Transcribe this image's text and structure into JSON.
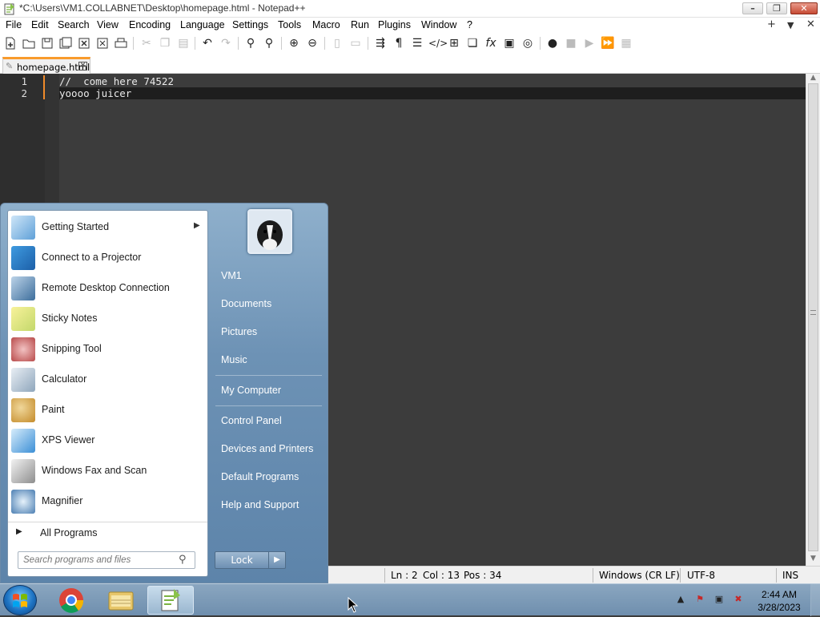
{
  "window": {
    "title": "*C:\\Users\\VM1.COLLABNET\\Desktop\\homepage.html - Notepad++",
    "minimize": "–",
    "restore": "❐",
    "close": "✕"
  },
  "menubar": {
    "items": [
      "File",
      "Edit",
      "Search",
      "View",
      "Encoding",
      "Language",
      "Settings",
      "Tools",
      "Macro",
      "Run",
      "Plugins",
      "Window",
      "?"
    ],
    "right": [
      "+",
      "▼",
      "✕"
    ]
  },
  "tab": {
    "label": "homepage.html",
    "close": "✕"
  },
  "editor": {
    "line_numbers": [
      "1",
      "2"
    ],
    "lines": [
      "//  come here 74522",
      "yoooo juicer"
    ]
  },
  "statusbar": {
    "ln": "Ln : 2",
    "col": "Col : 13",
    "pos": "Pos : 34",
    "eol": "Windows (CR LF)",
    "encoding": "UTF-8",
    "mode": "INS"
  },
  "startmenu": {
    "programs": [
      {
        "label": "Getting Started",
        "icon": "getting-started-icon",
        "submenu": true
      },
      {
        "label": "Connect to a Projector",
        "icon": "projector-icon"
      },
      {
        "label": "Remote Desktop Connection",
        "icon": "remote-desktop-icon"
      },
      {
        "label": "Sticky Notes",
        "icon": "sticky-notes-icon"
      },
      {
        "label": "Snipping Tool",
        "icon": "snipping-tool-icon"
      },
      {
        "label": "Calculator",
        "icon": "calculator-icon"
      },
      {
        "label": "Paint",
        "icon": "paint-icon"
      },
      {
        "label": "XPS Viewer",
        "icon": "xps-viewer-icon"
      },
      {
        "label": "Windows Fax and Scan",
        "icon": "fax-scan-icon"
      },
      {
        "label": "Magnifier",
        "icon": "magnifier-icon"
      }
    ],
    "all_programs": "All Programs",
    "search_placeholder": "Search programs and files",
    "places": [
      "VM1",
      "Documents",
      "Pictures",
      "Music",
      "My Computer",
      "Control Panel",
      "Devices and Printers",
      "Default Programs",
      "Help and Support"
    ],
    "lock": "Lock"
  },
  "taskbar": {
    "time": "2:44 AM",
    "date": "3/28/2023"
  },
  "colors": {
    "editor_bg": "#3c3c3c",
    "accent_orange": "#f99b2c",
    "startmenu_blue": "#6d92b5"
  }
}
